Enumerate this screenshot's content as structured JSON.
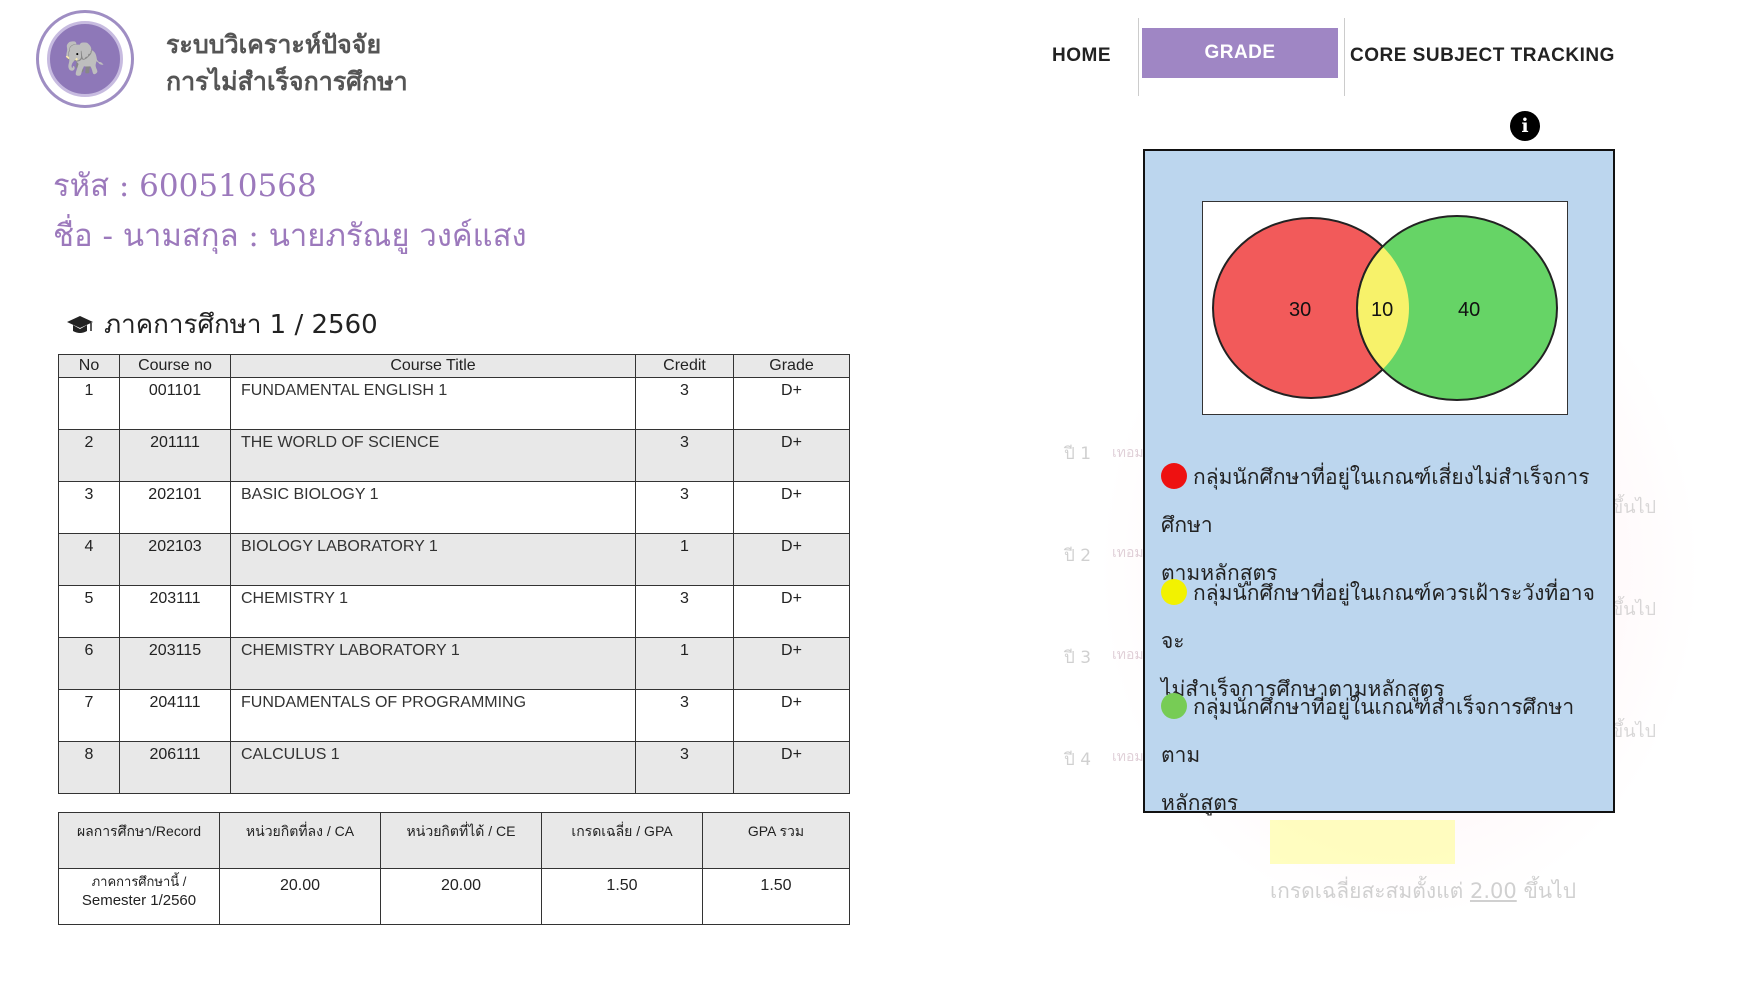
{
  "header": {
    "app_title_line1": "ระบบวิเคราะห์ปัจจัย",
    "app_title_line2": "การไม่สำเร็จการศึกษา",
    "logo_icon": "elephant-seal-icon"
  },
  "nav": {
    "home": "HOME",
    "grade_tracking": "GRADE TRACKING",
    "core_subject_tracking": "CORE SUBJECT TRACKING",
    "active_color": "#9f86c4"
  },
  "student": {
    "id_line": "รหัส : 600510568",
    "name_line": "ชื่อ - นามสกุล : นายภรัณยู วงค์แสง"
  },
  "semester": {
    "icon": "graduation-cap-icon",
    "label": "ภาคการศึกษา 1 / 2560"
  },
  "courses": {
    "headers": [
      "No",
      "Course no",
      "Course Title",
      "Credit",
      "Grade"
    ],
    "rows": [
      {
        "no": "1",
        "course_no": "001101",
        "title": "FUNDAMENTAL ENGLISH 1",
        "credit": "3",
        "grade": "D+"
      },
      {
        "no": "2",
        "course_no": "201111",
        "title": "THE WORLD OF SCIENCE",
        "credit": "3",
        "grade": "D+"
      },
      {
        "no": "3",
        "course_no": "202101",
        "title": "BASIC BIOLOGY 1",
        "credit": "3",
        "grade": "D+"
      },
      {
        "no": "4",
        "course_no": "202103",
        "title": "BIOLOGY LABORATORY 1",
        "credit": "1",
        "grade": "D+"
      },
      {
        "no": "5",
        "course_no": "203111",
        "title": "CHEMISTRY 1",
        "credit": "3",
        "grade": "D+"
      },
      {
        "no": "6",
        "course_no": "203115",
        "title": "CHEMISTRY LABORATORY 1",
        "credit": "1",
        "grade": "D+"
      },
      {
        "no": "7",
        "course_no": "204111",
        "title": "FUNDAMENTALS OF PROGRAMMING",
        "credit": "3",
        "grade": "D+"
      },
      {
        "no": "8",
        "course_no": "206111",
        "title": "CALCULUS 1",
        "credit": "3",
        "grade": "D+"
      }
    ]
  },
  "summary": {
    "headers": [
      "ผลการศึกษา/Record",
      "หน่วยกิตที่ลง / CA",
      "หน่วยกิตที่ได้ / CE",
      "เกรดเฉลี่ย / GPA",
      "GPA รวม"
    ],
    "row_label_line1": "ภาคการศึกษานี้ /",
    "row_label_line2": "Semester 1/2560",
    "ca": "20.00",
    "ce": "20.00",
    "gpa": "1.50",
    "gpa_total": "1.50"
  },
  "background_chart": {
    "rows": [
      "ปี 1",
      "ปี 2",
      "ปี 3",
      "ปี 4"
    ],
    "term_tag": "เทอม",
    "avg_text_prefix": "เกรดเฉลี่ยสะสมตั้งแต่",
    "avg_value": "2.00",
    "avg_text_suffix": "ขึ้นไป",
    "side_text": "ขึ้นไป"
  },
  "popup": {
    "info_icon": "info-icon",
    "venn": {
      "left_value": "30",
      "middle_value": "10",
      "right_value": "40",
      "left_color": "#f25a5a",
      "middle_color": "#f7f26a",
      "right_color": "#66d466"
    },
    "legend": [
      {
        "color": "#ee1111",
        "text_line1": "กลุ่มนักศึกษาที่อยู่ในเกณฑ์เสี่ยงไม่สำเร็จการศึกษา",
        "text_line2": "ตามหลักสูตร"
      },
      {
        "color": "#f2f200",
        "text_line1": "กลุ่มนักศึกษาที่อยู่ในเกณฑ์ควรเฝ้าระวังที่อาจจะ",
        "text_line2": "ไม่สำเร็จการศึกษาตามหลักสูตร"
      },
      {
        "color": "#77cc55",
        "text_line1": "กลุ่มนักศึกษาที่อยู่ในเกณฑ์สำเร็จการศึกษาตาม",
        "text_line2": "หลักสูตร"
      }
    ]
  }
}
